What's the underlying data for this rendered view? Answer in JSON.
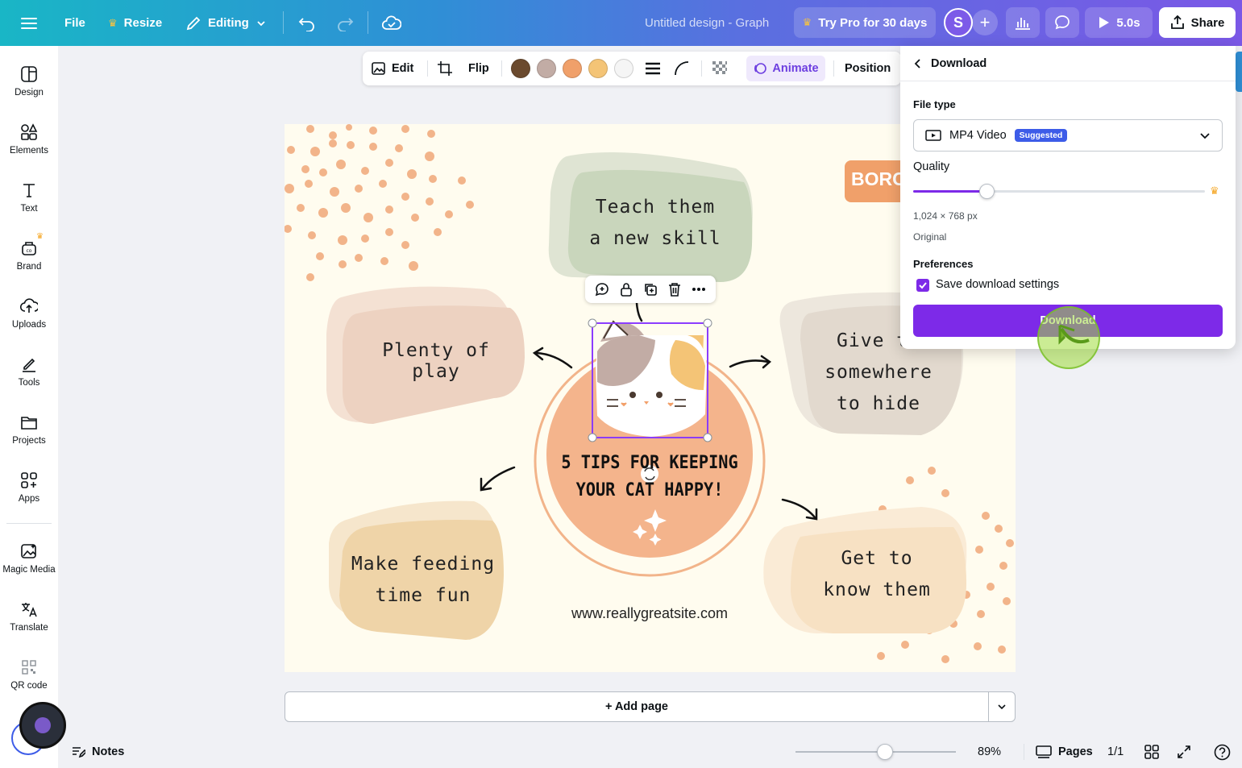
{
  "topbar": {
    "file": "File",
    "resize": "Resize",
    "editing": "Editing",
    "title": "Untitled design - Graph",
    "try_pro": "Try Pro for 30 days",
    "avatar_initial": "S",
    "play_time": "5.0s",
    "share": "Share"
  },
  "sidebar": {
    "items": [
      {
        "label": "Design"
      },
      {
        "label": "Elements"
      },
      {
        "label": "Text"
      },
      {
        "label": "Brand"
      },
      {
        "label": "Uploads"
      },
      {
        "label": "Tools"
      },
      {
        "label": "Projects"
      },
      {
        "label": "Apps"
      },
      {
        "label": "Magic Media"
      },
      {
        "label": "Translate"
      },
      {
        "label": "QR code"
      }
    ]
  },
  "context_toolbar": {
    "edit": "Edit",
    "flip": "Flip",
    "animate": "Animate",
    "position": "Position",
    "swatches": [
      "#6b4a2e",
      "#c2aca5",
      "#f0a06a",
      "#f4c476",
      "#f5f5f5"
    ]
  },
  "canvas": {
    "title_line1": "5 TIPS FOR KEEPING",
    "title_line2": "YOUR CAT HAPPY!",
    "tip_top_line1": "Teach them",
    "tip_top_line2": "a new skill",
    "tip_left": "Plenty of play",
    "tip_right_line1": "Give th",
    "tip_right_line2": "somewhere",
    "tip_right_line3": "to hide",
    "tip_bottom_left_line1": "Make feeding",
    "tip_bottom_left_line2": "time fun",
    "tip_bottom_right_line1": "Get to",
    "tip_bottom_right_line2": "know them",
    "badge": "BORC",
    "website": "www.reallygreatsite.com"
  },
  "add_page": "+ Add page",
  "bottom": {
    "notes": "Notes",
    "zoom": "89%",
    "zoom_fraction": 0.56,
    "pages": "Pages",
    "page_count": "1/1"
  },
  "download_panel": {
    "title": "Download",
    "file_type_label": "File type",
    "file_type_value": "MP4 Video",
    "suggested": "Suggested",
    "quality_label": "Quality",
    "quality_fraction": 0.25,
    "dimensions": "1,024 × 768 px",
    "quality_name": "Original",
    "preferences_label": "Preferences",
    "save_settings": "Save download settings",
    "download_button": "Download"
  }
}
